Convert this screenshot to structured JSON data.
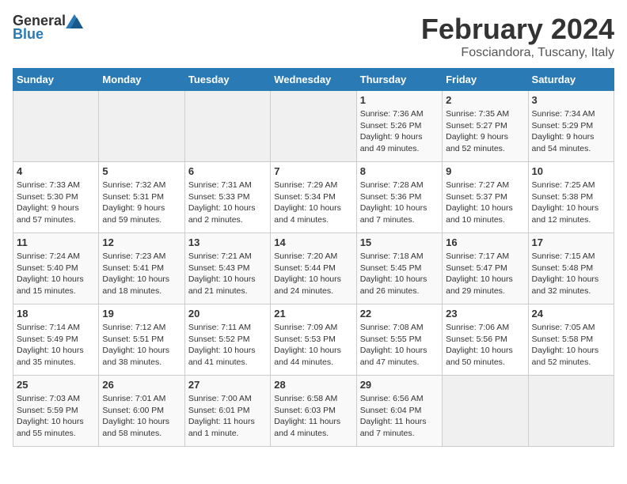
{
  "logo": {
    "text_general": "General",
    "text_blue": "Blue"
  },
  "title": "February 2024",
  "subtitle": "Fosciandora, Tuscany, Italy",
  "days_of_week": [
    "Sunday",
    "Monday",
    "Tuesday",
    "Wednesday",
    "Thursday",
    "Friday",
    "Saturday"
  ],
  "weeks": [
    [
      {
        "day": "",
        "info": ""
      },
      {
        "day": "",
        "info": ""
      },
      {
        "day": "",
        "info": ""
      },
      {
        "day": "",
        "info": ""
      },
      {
        "day": "1",
        "info": "Sunrise: 7:36 AM\nSunset: 5:26 PM\nDaylight: 9 hours\nand 49 minutes."
      },
      {
        "day": "2",
        "info": "Sunrise: 7:35 AM\nSunset: 5:27 PM\nDaylight: 9 hours\nand 52 minutes."
      },
      {
        "day": "3",
        "info": "Sunrise: 7:34 AM\nSunset: 5:29 PM\nDaylight: 9 hours\nand 54 minutes."
      }
    ],
    [
      {
        "day": "4",
        "info": "Sunrise: 7:33 AM\nSunset: 5:30 PM\nDaylight: 9 hours\nand 57 minutes."
      },
      {
        "day": "5",
        "info": "Sunrise: 7:32 AM\nSunset: 5:31 PM\nDaylight: 9 hours\nand 59 minutes."
      },
      {
        "day": "6",
        "info": "Sunrise: 7:31 AM\nSunset: 5:33 PM\nDaylight: 10 hours\nand 2 minutes."
      },
      {
        "day": "7",
        "info": "Sunrise: 7:29 AM\nSunset: 5:34 PM\nDaylight: 10 hours\nand 4 minutes."
      },
      {
        "day": "8",
        "info": "Sunrise: 7:28 AM\nSunset: 5:36 PM\nDaylight: 10 hours\nand 7 minutes."
      },
      {
        "day": "9",
        "info": "Sunrise: 7:27 AM\nSunset: 5:37 PM\nDaylight: 10 hours\nand 10 minutes."
      },
      {
        "day": "10",
        "info": "Sunrise: 7:25 AM\nSunset: 5:38 PM\nDaylight: 10 hours\nand 12 minutes."
      }
    ],
    [
      {
        "day": "11",
        "info": "Sunrise: 7:24 AM\nSunset: 5:40 PM\nDaylight: 10 hours\nand 15 minutes."
      },
      {
        "day": "12",
        "info": "Sunrise: 7:23 AM\nSunset: 5:41 PM\nDaylight: 10 hours\nand 18 minutes."
      },
      {
        "day": "13",
        "info": "Sunrise: 7:21 AM\nSunset: 5:43 PM\nDaylight: 10 hours\nand 21 minutes."
      },
      {
        "day": "14",
        "info": "Sunrise: 7:20 AM\nSunset: 5:44 PM\nDaylight: 10 hours\nand 24 minutes."
      },
      {
        "day": "15",
        "info": "Sunrise: 7:18 AM\nSunset: 5:45 PM\nDaylight: 10 hours\nand 26 minutes."
      },
      {
        "day": "16",
        "info": "Sunrise: 7:17 AM\nSunset: 5:47 PM\nDaylight: 10 hours\nand 29 minutes."
      },
      {
        "day": "17",
        "info": "Sunrise: 7:15 AM\nSunset: 5:48 PM\nDaylight: 10 hours\nand 32 minutes."
      }
    ],
    [
      {
        "day": "18",
        "info": "Sunrise: 7:14 AM\nSunset: 5:49 PM\nDaylight: 10 hours\nand 35 minutes."
      },
      {
        "day": "19",
        "info": "Sunrise: 7:12 AM\nSunset: 5:51 PM\nDaylight: 10 hours\nand 38 minutes."
      },
      {
        "day": "20",
        "info": "Sunrise: 7:11 AM\nSunset: 5:52 PM\nDaylight: 10 hours\nand 41 minutes."
      },
      {
        "day": "21",
        "info": "Sunrise: 7:09 AM\nSunset: 5:53 PM\nDaylight: 10 hours\nand 44 minutes."
      },
      {
        "day": "22",
        "info": "Sunrise: 7:08 AM\nSunset: 5:55 PM\nDaylight: 10 hours\nand 47 minutes."
      },
      {
        "day": "23",
        "info": "Sunrise: 7:06 AM\nSunset: 5:56 PM\nDaylight: 10 hours\nand 50 minutes."
      },
      {
        "day": "24",
        "info": "Sunrise: 7:05 AM\nSunset: 5:58 PM\nDaylight: 10 hours\nand 52 minutes."
      }
    ],
    [
      {
        "day": "25",
        "info": "Sunrise: 7:03 AM\nSunset: 5:59 PM\nDaylight: 10 hours\nand 55 minutes."
      },
      {
        "day": "26",
        "info": "Sunrise: 7:01 AM\nSunset: 6:00 PM\nDaylight: 10 hours\nand 58 minutes."
      },
      {
        "day": "27",
        "info": "Sunrise: 7:00 AM\nSunset: 6:01 PM\nDaylight: 11 hours\nand 1 minute."
      },
      {
        "day": "28",
        "info": "Sunrise: 6:58 AM\nSunset: 6:03 PM\nDaylight: 11 hours\nand 4 minutes."
      },
      {
        "day": "29",
        "info": "Sunrise: 6:56 AM\nSunset: 6:04 PM\nDaylight: 11 hours\nand 7 minutes."
      },
      {
        "day": "",
        "info": ""
      },
      {
        "day": "",
        "info": ""
      }
    ]
  ]
}
